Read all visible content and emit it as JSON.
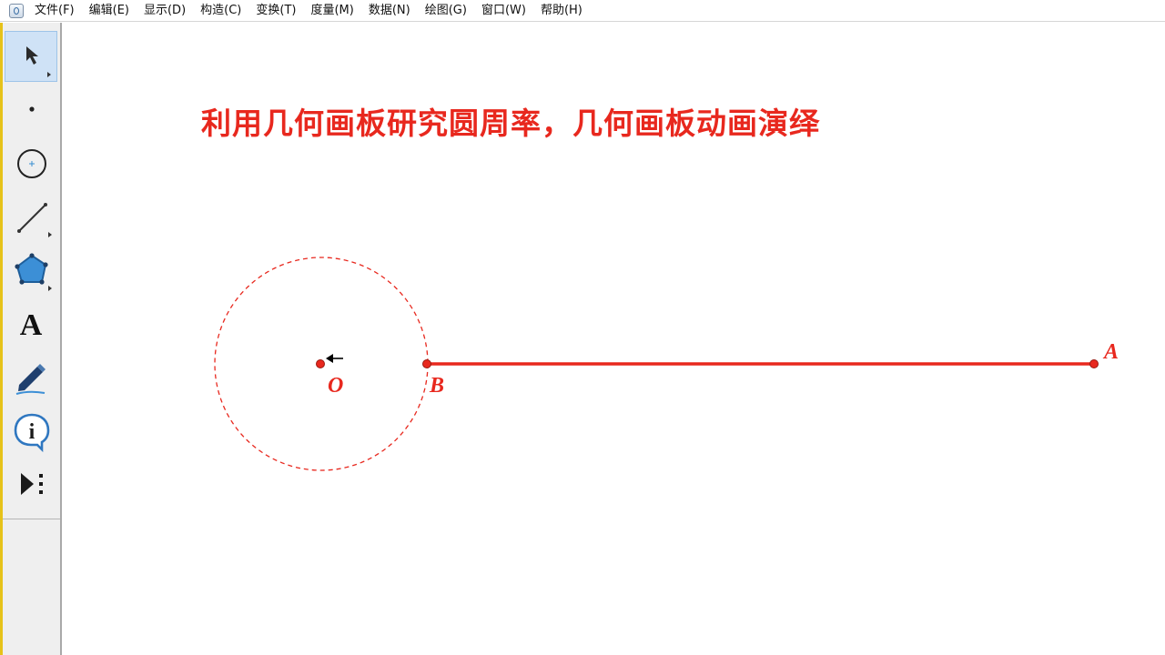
{
  "menu": [
    "文件(F)",
    "编辑(E)",
    "显示(D)",
    "构造(C)",
    "变换(T)",
    "度量(M)",
    "数据(N)",
    "绘图(G)",
    "窗口(W)",
    "帮助(H)"
  ],
  "toolbar": {
    "tools": [
      "arrow-select-tool",
      "point-tool",
      "compass-tool",
      "straightedge-tool",
      "polygon-tool",
      "text-tool",
      "marker-tool",
      "information-tool",
      "custom-tool"
    ],
    "text_tool_glyph": "A",
    "info_tool_glyph": "i",
    "selected": "arrow-select-tool"
  },
  "canvas": {
    "title": "利用几何画板研究圆周率，几何画板动画演绎",
    "points": {
      "O": "O",
      "B": "B",
      "A": "A"
    }
  },
  "colors": {
    "accent_red": "#e8281e",
    "selected_tool_bg": "#cfe2f6",
    "toolbar_bg": "#efefef"
  }
}
